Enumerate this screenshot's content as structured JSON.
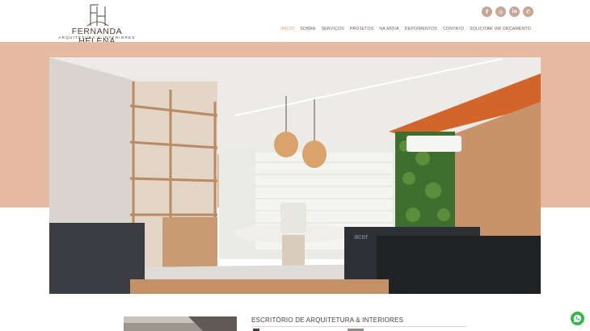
{
  "brand": {
    "name": "FERNANDA HELENA",
    "tagline": "ARQUITETURA & INTERIORES",
    "accent": "#d4956e",
    "hero_band_color": "#e6b9a2"
  },
  "social": [
    {
      "name": "facebook-icon",
      "glyph": "f"
    },
    {
      "name": "instagram-icon",
      "glyph": "◎"
    },
    {
      "name": "linkedin-icon",
      "glyph": "in"
    },
    {
      "name": "whatsapp-icon",
      "glyph": "✆"
    }
  ],
  "nav": {
    "items": [
      {
        "label": "INÍCIO",
        "active": true
      },
      {
        "label": "SOBRE"
      },
      {
        "label": "SERVIÇOS"
      },
      {
        "label": "PROJETOS"
      },
      {
        "label": "NA MÍDIA"
      },
      {
        "label": "DEPOIMENTOS"
      },
      {
        "label": "CONTATO"
      },
      {
        "label": "SOLICITAR UM ORÇAMENTO"
      }
    ]
  },
  "hero": {
    "monitor_brand": "acer"
  },
  "about": {
    "title": "ESCRITÓRIO DE ARQUITETURA & INTERIORES"
  }
}
